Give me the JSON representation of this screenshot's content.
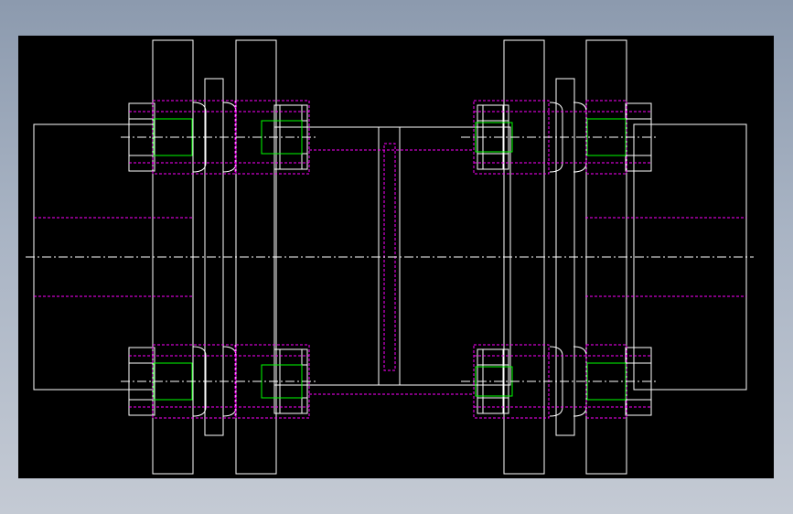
{
  "colors": {
    "viewport_bg": "#000000",
    "outline": "#ffffff",
    "hidden_line": "#ff00ff",
    "thread_line": "#00ff00",
    "center_line": "#ffffff",
    "window_bg": "#9aa6b8"
  },
  "drawing": {
    "type": "cad-2d-view",
    "subject": "flanged-disc-coupling",
    "view": "front-elevation",
    "visible_text": []
  }
}
